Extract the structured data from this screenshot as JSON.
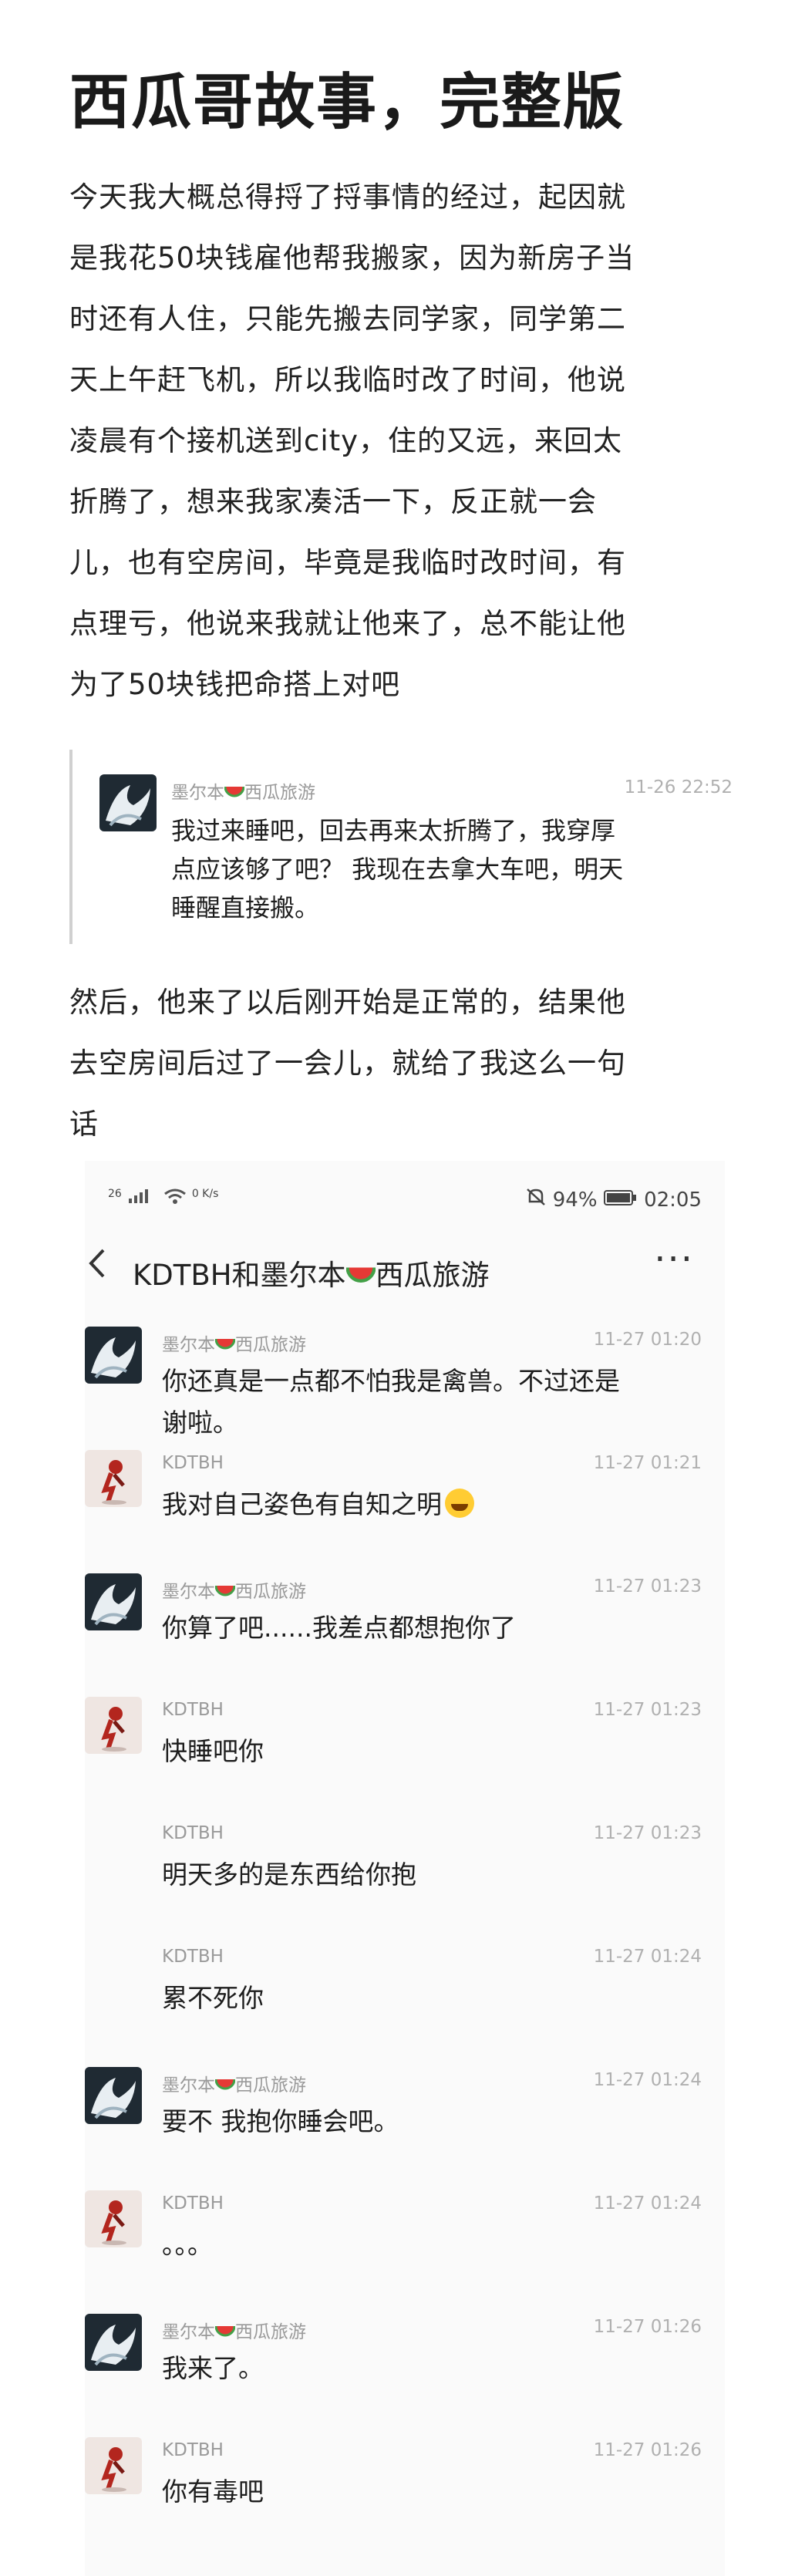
{
  "article": {
    "title": "西瓜哥故事，完整版",
    "intro_lines": [
      "今天我大概总得捋了捋事情的经过，起因就",
      "是我花50块钱雇他帮我搬家，因为新房子当",
      "时还有人住，只能先搬去同学家，同学第二",
      "天上午赶飞机，所以我临时改了时间，他说",
      "凌晨有个接机送到city，住的又远，来回太",
      "折腾了，想来我家凑活一下，反正就一会",
      "儿，也有空房间，毕竟是我临时改时间，有",
      "点理亏，他说来我就让他来了，总不能让他",
      "为了50块钱把命搭上对吧"
    ],
    "mid_lines": [
      "然后，他来了以后刚开始是正常的，结果他",
      "去空房间后过了一会儿，就给了我这么一句",
      "话"
    ]
  },
  "quote": {
    "name": "墨尔本",
    "name_suffix": "西瓜旅游",
    "time": "11-26 22:52",
    "lines": [
      "我过来睡吧，回去再来太折腾了，我穿厚",
      "点应该够了吧？ 我现在去拿大车吧，明天",
      "睡醒直接搬。"
    ]
  },
  "screenshot": {
    "status": {
      "signal": "26",
      "speed": "0 K/s",
      "battery": "94%",
      "clock": "02:05"
    },
    "header": {
      "back_icon": "chevron-left-icon",
      "title_a": "KDTBH和墨尔本",
      "title_b": "西瓜旅游",
      "more": "···"
    },
    "messages": [
      {
        "sender": "melbourne",
        "name": "墨尔本",
        "suffix": "西瓜旅游",
        "time": "11-27 01:20",
        "lines": [
          "你还真是一点都不怕我是禽兽。不过还是",
          "谢啦。"
        ],
        "avatar": true
      },
      {
        "sender": "kdtbh",
        "name": "KDTBH",
        "suffix": "",
        "time": "11-27 01:21",
        "lines": [
          "我对自己姿色有自知之明"
        ],
        "emoji": true,
        "avatar": true
      },
      {
        "sender": "melbourne",
        "name": "墨尔本",
        "suffix": "西瓜旅游",
        "time": "11-27 01:23",
        "lines": [
          "你算了吧......我差点都想抱你了"
        ],
        "avatar": true
      },
      {
        "sender": "kdtbh",
        "name": "KDTBH",
        "suffix": "",
        "time": "11-27 01:23",
        "lines": [
          "快睡吧你"
        ],
        "avatar": true
      },
      {
        "sender": "kdtbh",
        "name": "KDTBH",
        "suffix": "",
        "time": "11-27 01:23",
        "lines": [
          "明天多的是东西给你抱"
        ],
        "avatar": false
      },
      {
        "sender": "kdtbh",
        "name": "KDTBH",
        "suffix": "",
        "time": "11-27 01:24",
        "lines": [
          "累不死你"
        ],
        "avatar": false
      },
      {
        "sender": "melbourne",
        "name": "墨尔本",
        "suffix": "西瓜旅游",
        "time": "11-27 01:24",
        "lines": [
          "要不 我抱你睡会吧。"
        ],
        "avatar": true
      },
      {
        "sender": "kdtbh",
        "name": "KDTBH",
        "suffix": "",
        "time": "11-27 01:24",
        "lines": [
          "。。。"
        ],
        "avatar": true
      },
      {
        "sender": "melbourne",
        "name": "墨尔本",
        "suffix": "西瓜旅游",
        "time": "11-27 01:26",
        "lines": [
          "我来了。"
        ],
        "avatar": true
      },
      {
        "sender": "kdtbh",
        "name": "KDTBH",
        "suffix": "",
        "time": "11-27 01:26",
        "lines": [
          "你有毒吧"
        ],
        "avatar": true
      }
    ]
  }
}
